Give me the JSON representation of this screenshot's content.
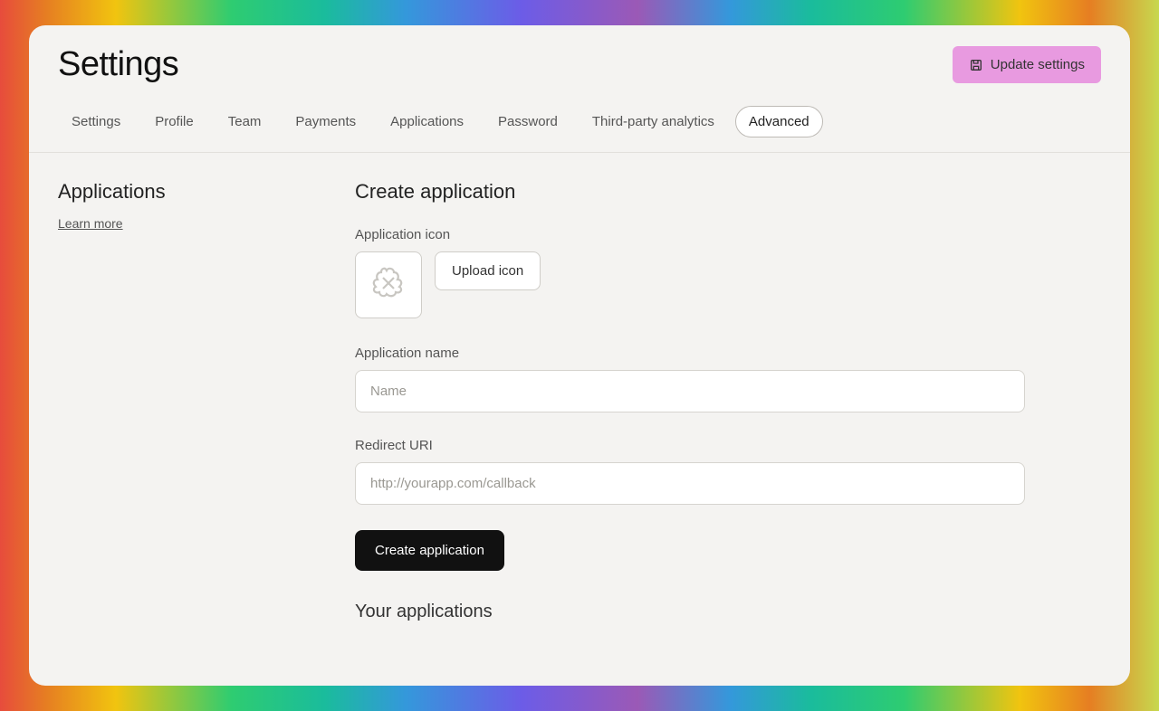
{
  "header": {
    "title": "Settings",
    "update_button": "Update settings"
  },
  "tabs": [
    {
      "label": "Settings",
      "active": false
    },
    {
      "label": "Profile",
      "active": false
    },
    {
      "label": "Team",
      "active": false
    },
    {
      "label": "Payments",
      "active": false
    },
    {
      "label": "Applications",
      "active": false
    },
    {
      "label": "Password",
      "active": false
    },
    {
      "label": "Third-party analytics",
      "active": false
    },
    {
      "label": "Advanced",
      "active": true
    }
  ],
  "sidebar": {
    "title": "Applications",
    "learn_more": "Learn more"
  },
  "form": {
    "title": "Create application",
    "icon_label": "Application icon",
    "upload_button": "Upload icon",
    "name_label": "Application name",
    "name_placeholder": "Name",
    "redirect_label": "Redirect URI",
    "redirect_placeholder": "http://yourapp.com/callback",
    "submit_button": "Create application"
  },
  "your_applications_title": "Your applications"
}
